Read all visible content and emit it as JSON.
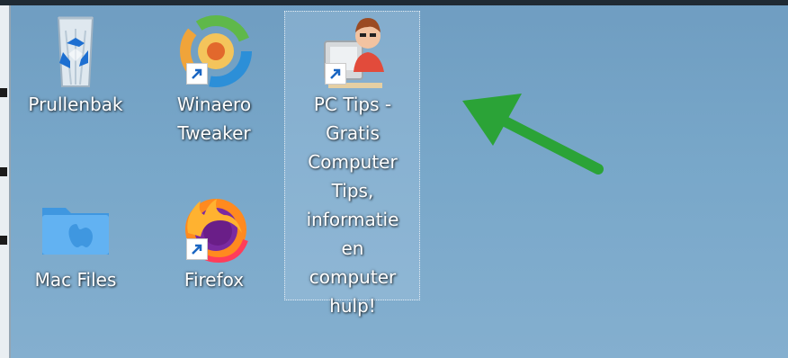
{
  "desktop": {
    "icons": [
      {
        "label": "Prullenbak",
        "icon": "recycle-bin-icon",
        "shortcut": false
      },
      {
        "label": "Winaero\nTweaker",
        "icon": "winaero-tweaker-icon",
        "shortcut": true
      },
      {
        "label": "PC Tips -\nGratis\nComputer\nTips,\ninformatie en\ncomputer\nhulp!",
        "icon": "pc-tips-icon",
        "shortcut": true,
        "selected": true
      },
      {
        "label": "Mac Files",
        "icon": "folder-icon",
        "shortcut": false
      },
      {
        "label": "Firefox",
        "icon": "firefox-icon",
        "shortcut": true
      }
    ]
  },
  "colors": {
    "desktop_background": "#78a7c9",
    "arrow": "#2ba337",
    "selection_fill": "#aac8e1"
  }
}
